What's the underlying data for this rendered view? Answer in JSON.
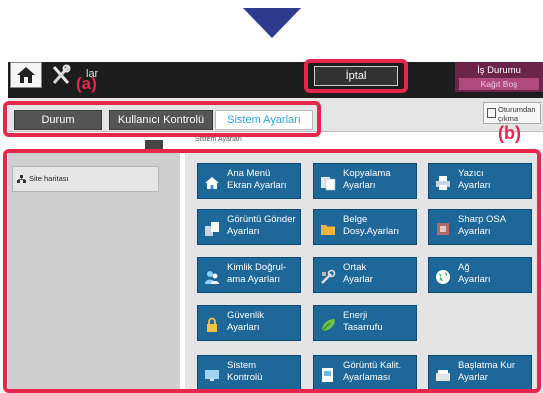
{
  "header": {
    "app_title": "Ayarlar",
    "app_title_visible": "lar",
    "cancel_label": "İptal",
    "job_status": {
      "title": "İş Durumu",
      "subtitle": "Kağıt Boş"
    },
    "icons": {
      "home": "home-icon",
      "tools": "tools-icon"
    }
  },
  "tabs": [
    {
      "label": "Durum",
      "active": false
    },
    {
      "label": "Kullanıcı Kontrolü",
      "active": false
    },
    {
      "label": "Sistem Ayarları",
      "active": true
    }
  ],
  "logout": {
    "line1": "Oturumdan",
    "line2": "çıkma",
    "icon": "logout-icon"
  },
  "breadcrumb": "Sistem Ayarları",
  "sidebar": {
    "items": [
      {
        "label": "Site haritası",
        "icon": "sitemap-icon"
      }
    ]
  },
  "tiles": [
    {
      "label": "Ana Menü\nEkran Ayarları",
      "icon": "home-icon"
    },
    {
      "label": "Kopyalama\nAyarları",
      "icon": "copy-icon"
    },
    {
      "label": "Yazıcı\nAyarları",
      "icon": "printer-icon"
    },
    {
      "label": "Görüntü Gönder\nAyarları",
      "icon": "image-send-icon"
    },
    {
      "label": "Belge\nDosy.Ayarları",
      "icon": "folder-icon"
    },
    {
      "label": "Sharp OSA\nAyarları",
      "icon": "osa-icon"
    },
    {
      "label": "Kimlik Doğrul-\nama Ayarları",
      "icon": "users-icon"
    },
    {
      "label": "Ortak\nAyarlar",
      "icon": "common-settings-icon"
    },
    {
      "label": "Ağ\nAyarları",
      "icon": "network-globe-icon"
    },
    {
      "label": "Güvenlik\nAyarları",
      "icon": "lock-icon"
    },
    {
      "label": "Enerji\nTasarrufu",
      "icon": "leaf-icon"
    },
    {
      "label": "Sistem\nKontrolü",
      "icon": "monitor-icon"
    },
    {
      "label": "Görüntü Kalit.\nAyarlaması",
      "icon": "image-quality-icon"
    },
    {
      "label": "Başlatma Kur\nAyarlar",
      "icon": "startup-icon"
    }
  ],
  "callouts": {
    "a": "(a)",
    "b": "(b)"
  },
  "colors": {
    "tile": "#1e6799",
    "accent": "#2aa3e0",
    "highlight": "#e8254a",
    "job_status": "#6a2548",
    "arrow": "#2f3b8f"
  }
}
